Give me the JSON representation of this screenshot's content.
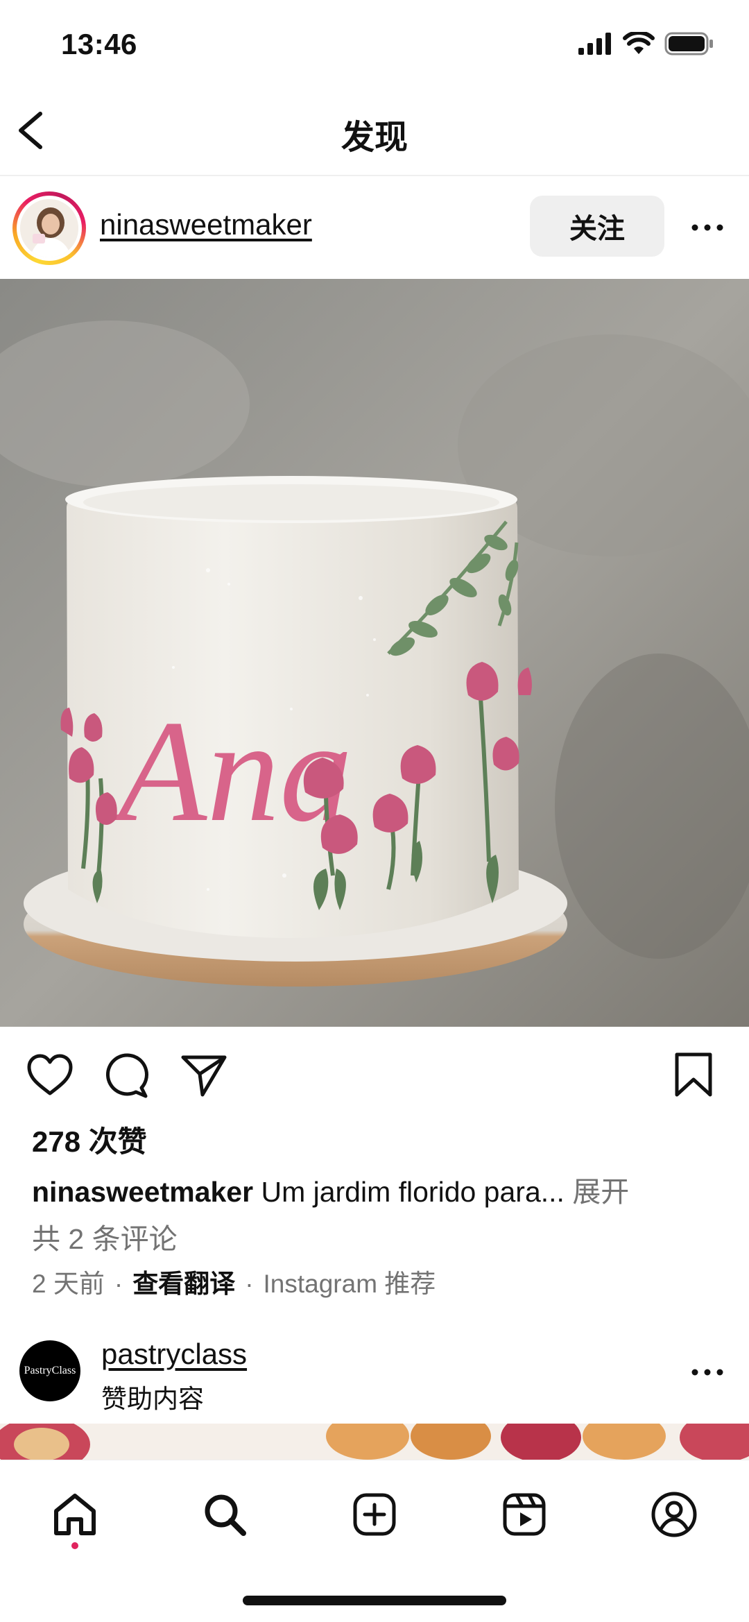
{
  "status_bar": {
    "time": "13:46",
    "icons": [
      "cellular-signal-icon",
      "wifi-icon",
      "battery-icon"
    ]
  },
  "header": {
    "title": "发现",
    "back_icon": "chevron-left-icon"
  },
  "post": {
    "username": "ninasweetmaker",
    "follow_label": "关注",
    "more_icon": "more-horizontal-icon",
    "image_text": "Ana",
    "actions": [
      "heart-icon",
      "comment-icon",
      "share-icon",
      "bookmark-icon"
    ],
    "likes": "278 次赞",
    "caption_username": "ninasweetmaker",
    "caption_text": " Um jardim florido para... ",
    "caption_more": "展开",
    "comments": "共 2 条评论",
    "time": "2 天前",
    "translate": "查看翻译",
    "source": "Instagram 推荐",
    "separator": "·"
  },
  "next_post": {
    "username": "pastryclass",
    "subtitle": "赞助内容",
    "avatar_text": "PastryClass"
  },
  "tab_bar": {
    "tabs": [
      "home-icon",
      "search-icon",
      "create-icon",
      "reels-icon",
      "profile-icon"
    ],
    "active": "home-icon"
  },
  "colors": {
    "accent_pink": "#d8648a",
    "story_ring_start": "#fdd835",
    "story_ring_end": "#e91e63",
    "notification_dot": "#e0245e"
  }
}
